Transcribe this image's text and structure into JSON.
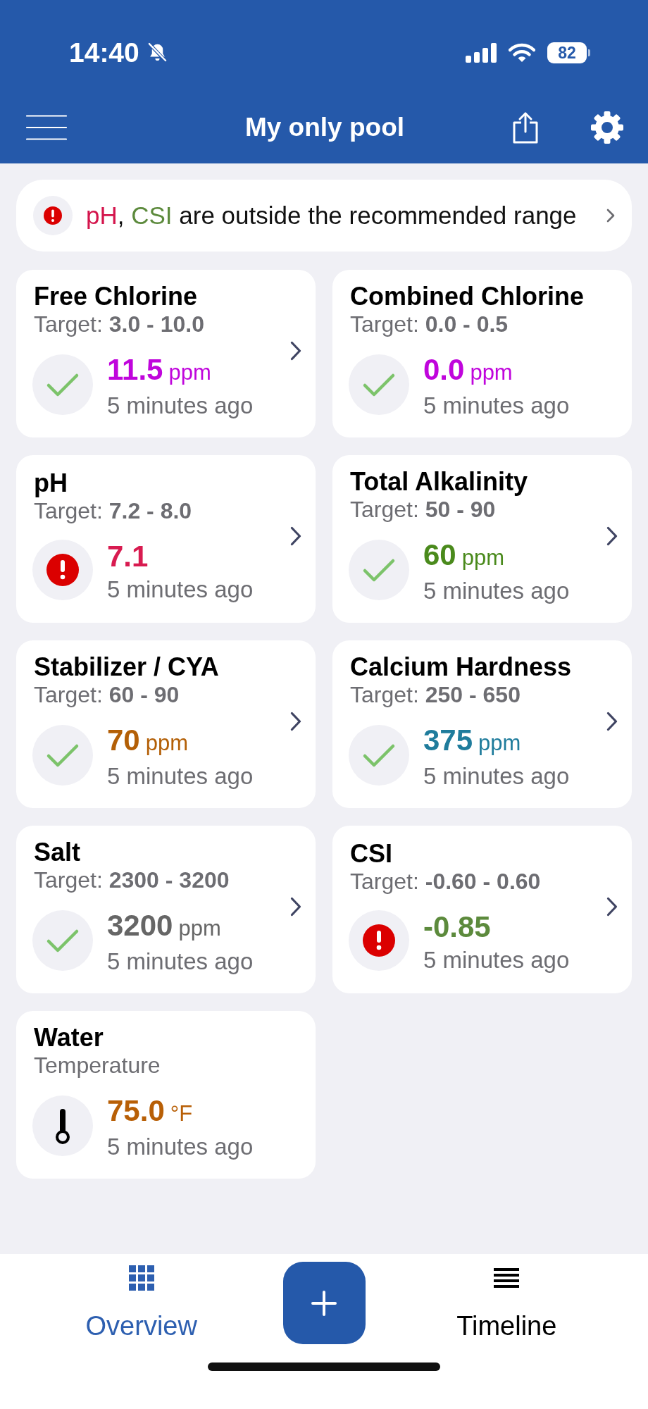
{
  "status_bar": {
    "time": "14:40",
    "battery": "82"
  },
  "header": {
    "title": "My only pool"
  },
  "alert": {
    "flagged": [
      {
        "name": "pH",
        "color": "#d4154c"
      },
      {
        "name": "CSI",
        "color": "#5c8a3c"
      }
    ],
    "separator": ",",
    "message": "are outside the recommended range"
  },
  "metrics": [
    {
      "kind": "reading",
      "name": "Free Chlorine",
      "target": "Target: **3.0 - 10.0**",
      "out_of_range": false,
      "value": "11.5",
      "unit": "ppm",
      "color": "#c005dc",
      "time": "5 minutes ago",
      "has_details": true
    },
    {
      "kind": "reading",
      "name": "Combined Chlorine",
      "target": "Target: **0.0 - 0.5**",
      "out_of_range": false,
      "value": "0.0",
      "unit": "ppm",
      "color": "#c005dc",
      "time": "5 minutes ago",
      "has_details": false
    },
    {
      "kind": "reading",
      "name": "pH",
      "target": "Target: **7.2 - 8.0**",
      "out_of_range": true,
      "value": "7.1",
      "color": "#d81b50",
      "time": "5 minutes ago",
      "has_details": true
    },
    {
      "kind": "reading",
      "name": "Total Alkalinity",
      "target": "Target: **50 - 90**",
      "out_of_range": false,
      "value": "60",
      "unit": "ppm",
      "color": "#4a8a1c",
      "time": "5 minutes ago",
      "has_details": true
    },
    {
      "kind": "reading",
      "name": "Stabilizer / CYA",
      "target": "Target: **60 - 90**",
      "out_of_range": false,
      "value": "70",
      "unit": "ppm",
      "color": "#b35f06",
      "time": "5 minutes ago",
      "has_details": true
    },
    {
      "kind": "reading",
      "name": "Calcium Hardness",
      "target": "Target: **250 - 650**",
      "out_of_range": false,
      "value": "375",
      "unit": "ppm",
      "color": "#1f7c9c",
      "time": "5 minutes ago",
      "has_details": true
    },
    {
      "kind": "reading",
      "name": "Salt",
      "target": "Target: **2300 - 3200**",
      "out_of_range": false,
      "value": "3200",
      "unit": "ppm",
      "color": "#666666",
      "time": "5 minutes ago",
      "has_details": true
    },
    {
      "kind": "reading",
      "name": "CSI",
      "target": "Target: **-0.60 - 0.60**",
      "out_of_range": true,
      "value": "-0.85",
      "color": "#5c8a3c",
      "time": "5 minutes ago",
      "has_details": true
    },
    {
      "kind": "temperature",
      "name": "Water",
      "subtitle": "Temperature",
      "value": "75.0",
      "unit": "°F",
      "color": "#b85f06",
      "time": "5 minutes ago",
      "has_details": false
    }
  ],
  "bottom_nav": {
    "tabs": [
      {
        "label": "Overview",
        "selected": true
      },
      {
        "label": "Timeline",
        "selected": false
      }
    ]
  }
}
